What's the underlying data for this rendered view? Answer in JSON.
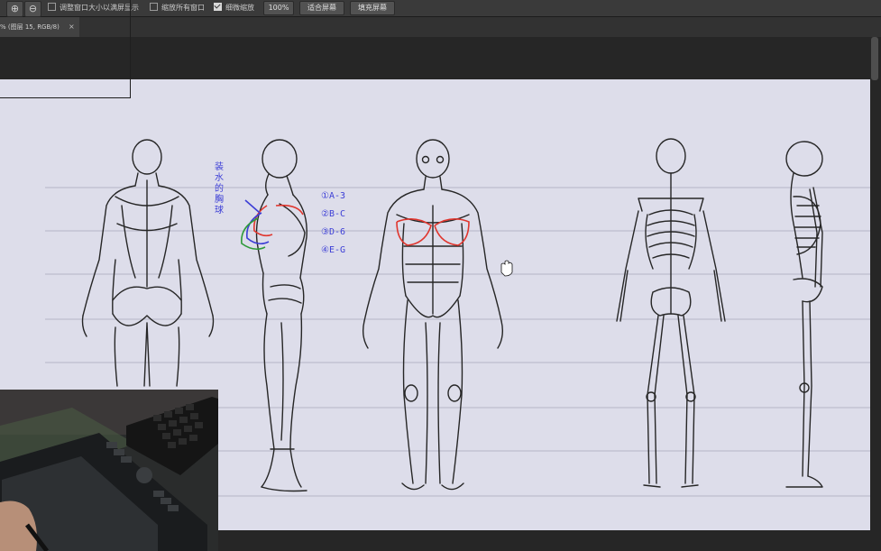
{
  "options_bar": {
    "zoom_in_icon": "zoom-in-icon",
    "zoom_out_icon": "zoom-out-icon",
    "resize_windows_label": "调整窗口大小以满屏显示",
    "resize_windows_checked": false,
    "zoom_all_windows_label": "缩放所有窗口",
    "zoom_all_windows_checked": false,
    "scrubby_zoom_label": "细微缩放",
    "scrubby_zoom_checked": true,
    "zoom_100_label": "100%",
    "fit_screen_label": "适合屏幕",
    "fill_screen_label": "填充屏幕"
  },
  "document_tab": {
    "title": "% (图层 15, RGB/8)",
    "close_label": "×"
  },
  "annotations": {
    "vertical_note": [
      "装",
      "水",
      "的",
      "胸",
      "球"
    ],
    "sizes": [
      "①A-3",
      "②B-C",
      "③D-6",
      "④E-G"
    ]
  },
  "colors": {
    "ui_bar": "#3a3a3a",
    "paper": "#ddddea",
    "ink_blue": "#3c3ed6",
    "ink_red": "#e0362e",
    "ink_green": "#2e9a3a"
  }
}
